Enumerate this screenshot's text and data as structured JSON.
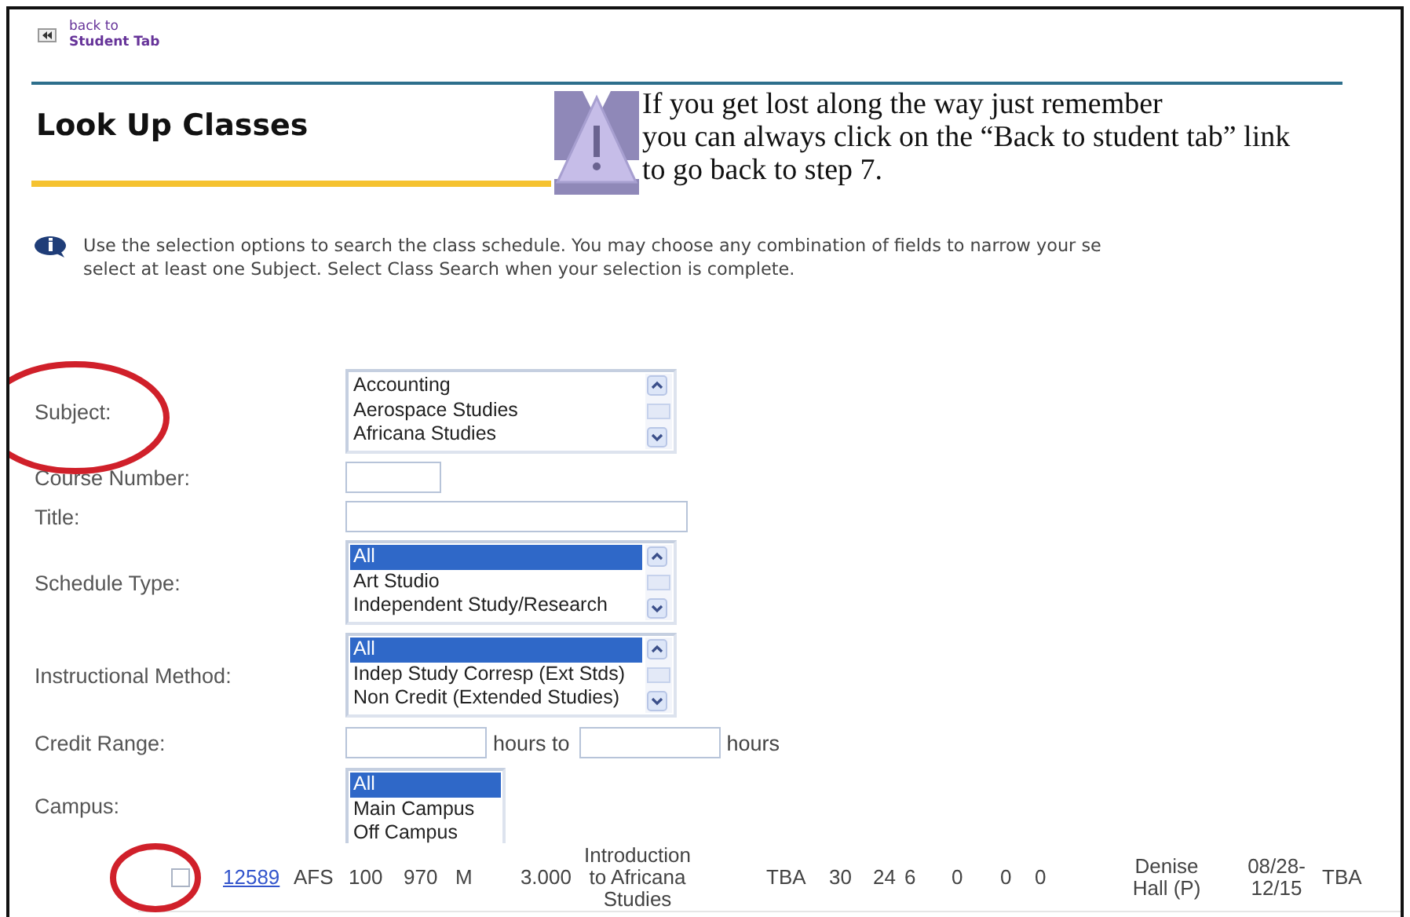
{
  "back_link": {
    "lines": [
      "back to",
      "**Student Tab**"
    ]
  },
  "page_title": "Look Up Classes",
  "callout": {
    "lines": [
      "If you get lost along the way just remember",
      "you can always click on the “Back to student tab” link",
      "to go back to step 7."
    ]
  },
  "intro": {
    "lines": [
      "Use the selection options to search the class schedule. You may choose any combination of fields to narrow your se",
      "select at least one Subject. Select Class Search when your selection is complete."
    ]
  },
  "form": {
    "fields": [
      {
        "label": "Subject:",
        "kind": "listbox",
        "circled": true,
        "options": [
          {
            "text": "Accounting",
            "selected": false
          },
          {
            "text": "Aerospace Studies",
            "selected": false
          },
          {
            "text": "Africana Studies",
            "selected": false
          }
        ]
      },
      {
        "label": "Course Number:",
        "kind": "short-text"
      },
      {
        "label": "Title:",
        "kind": "long-text"
      },
      {
        "label": "Schedule Type:",
        "kind": "listbox",
        "options": [
          {
            "text": "All",
            "selected": true
          },
          {
            "text": "Art Studio",
            "selected": false
          },
          {
            "text": "Independent Study/Research",
            "selected": false
          }
        ]
      },
      {
        "label": "Instructional Method:",
        "kind": "listbox",
        "options": [
          {
            "text": "All",
            "selected": true
          },
          {
            "text": "Indep Study Corresp (Ext Stds)",
            "selected": false
          },
          {
            "text": "Non Credit (Extended Studies)",
            "selected": false
          }
        ]
      },
      {
        "label": "Credit Range:",
        "kind": "range",
        "middle": "hours to",
        "unit": "hours"
      },
      {
        "label": "Campus:",
        "kind": "short-listbox",
        "options": [
          {
            "text": "All",
            "selected": true
          },
          {
            "text": "Main Campus",
            "selected": false
          },
          {
            "text": "Off Campus",
            "selected": false
          }
        ]
      }
    ]
  },
  "result_row": {
    "checked": false,
    "circled": true,
    "crn": "12589",
    "cells": [
      "AFS",
      "100",
      "970",
      "M",
      "3.000",
      "Introduction to Africana Studies",
      "TBA",
      "30",
      "24",
      "6",
      "0",
      "0",
      "0",
      "Denise Hall (P)",
      "08/28-12/15",
      "TBA"
    ]
  }
}
